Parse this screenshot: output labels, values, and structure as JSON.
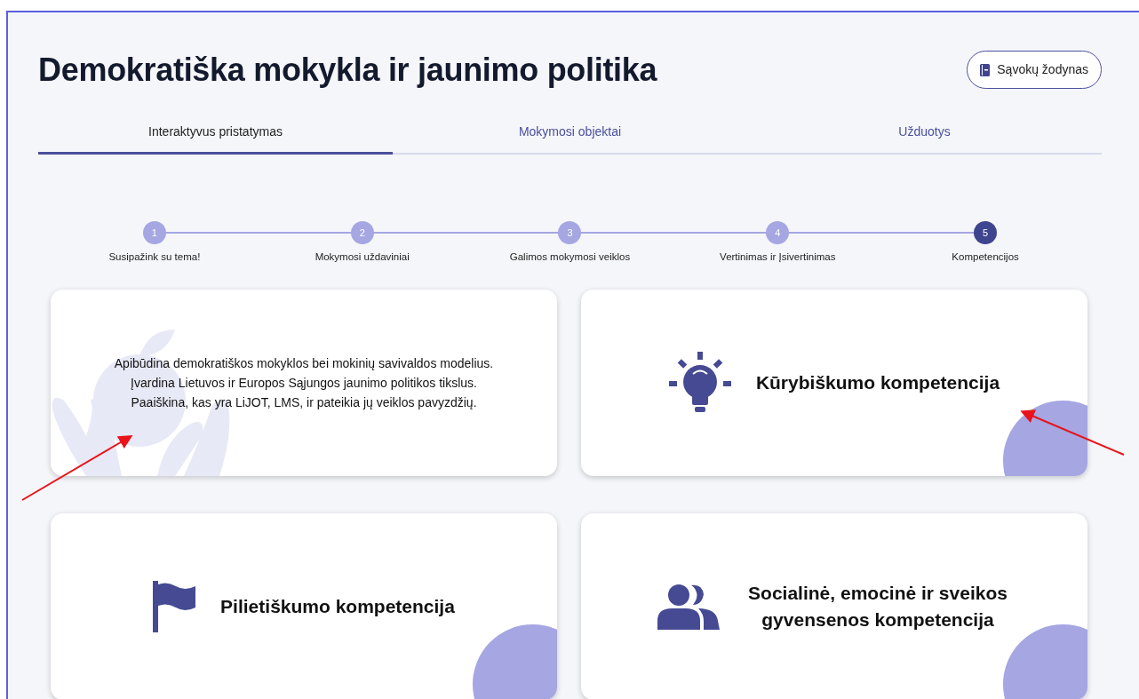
{
  "title": "Demokratiška mokykla ir jaunimo politika",
  "glossary_button": {
    "label": "Sąvokų žodynas"
  },
  "tabs": [
    {
      "label": "Interaktyvus pristatymas",
      "selected": true
    },
    {
      "label": "Mokymosi objektai",
      "selected": false
    },
    {
      "label": "Užduotys",
      "selected": false
    }
  ],
  "steps": [
    {
      "number": "1",
      "label": "Susipažink su tema!",
      "selected": false
    },
    {
      "number": "2",
      "label": "Mokymosi uždaviniai",
      "selected": false
    },
    {
      "number": "3",
      "label": "Galimos mokymosi veiklos",
      "selected": false
    },
    {
      "number": "4",
      "label": "Vertinimas ir Įsivertinimas",
      "selected": false
    },
    {
      "number": "5",
      "label": "Kompetencijos",
      "selected": true
    }
  ],
  "cards": [
    {
      "kind": "description",
      "text": "Apibūdina demokratiškos mokyklos bei mokinių savivaldos modelius. Įvardina Lietuvos ir Europos Sąjungos jaunimo politikos tikslus. Paaiškina, kas yra LiJOT, LMS, ir pateikia jų veiklos pavyzdžių."
    },
    {
      "kind": "competency",
      "title": "Kūrybiškumo kompetencija"
    },
    {
      "kind": "competency",
      "title": "Pilietiškumo kompetencija"
    },
    {
      "kind": "competency",
      "title": "Socialinė, emocinė ir sveikos gyvensenos kompetencija"
    }
  ]
}
